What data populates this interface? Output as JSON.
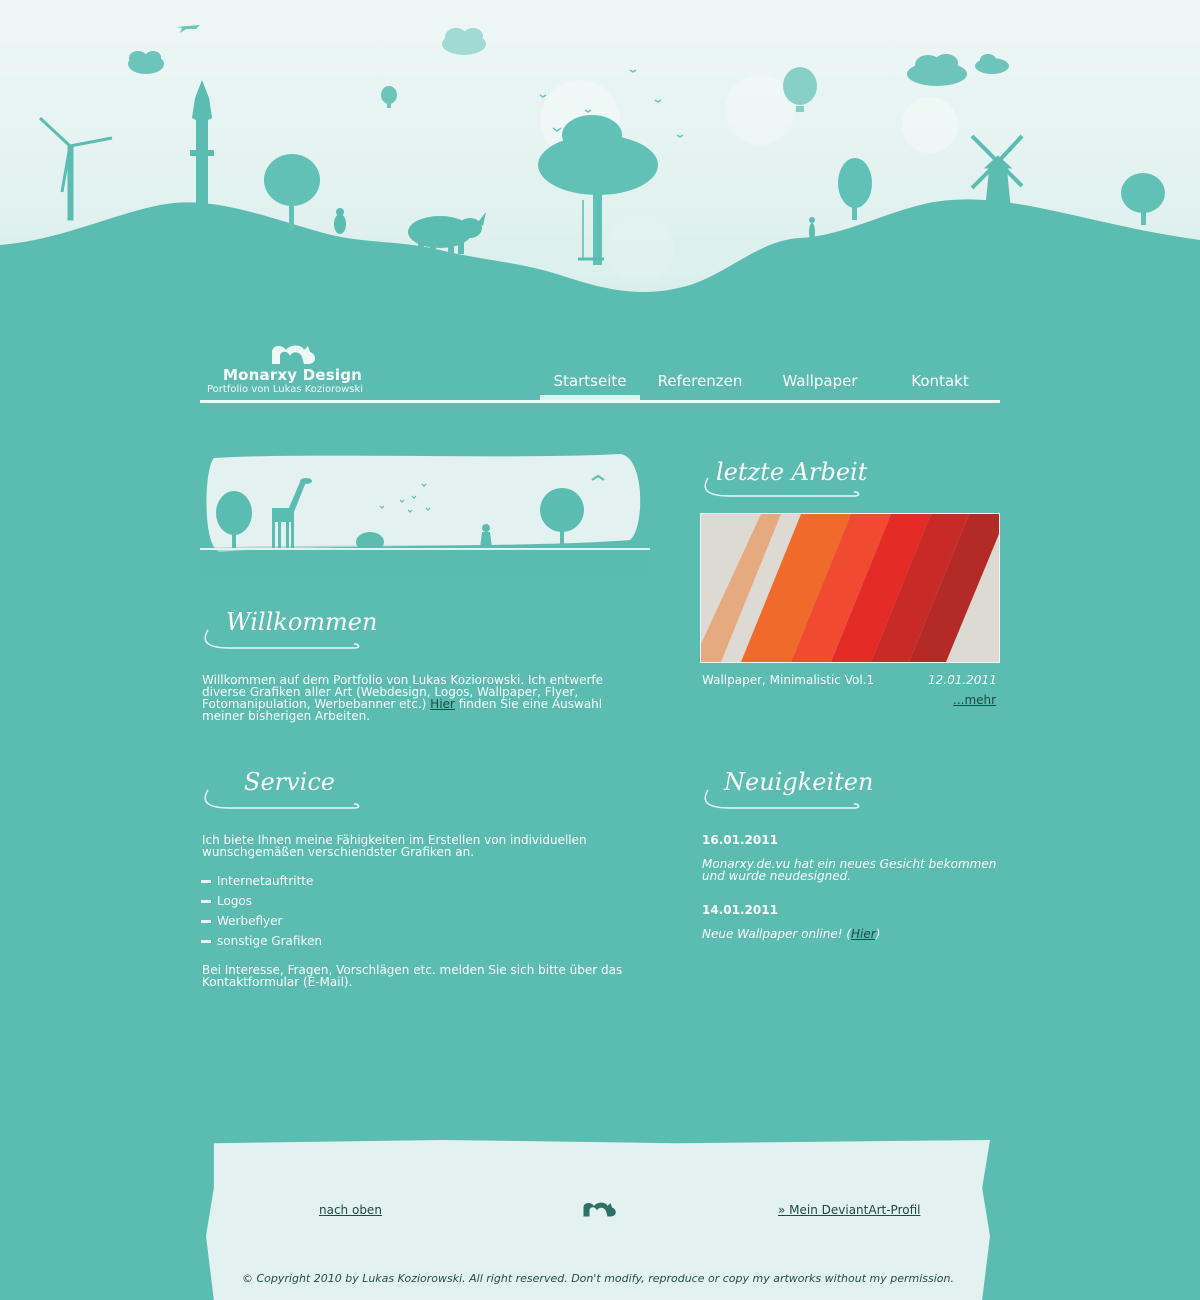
{
  "brand": {
    "title": "Monarxy Design",
    "subtitle": "Portfolio von Lukas Koziorowski"
  },
  "nav": [
    {
      "label": "Startseite",
      "active": true
    },
    {
      "label": "Referenzen",
      "active": false
    },
    {
      "label": "Wallpaper",
      "active": false
    },
    {
      "label": "Kontakt",
      "active": false
    }
  ],
  "colors": {
    "background": "#5bbcb1",
    "sky": "#e3f2f0",
    "dark_link": "#1f4a45",
    "silhouette": "#5bbcb1"
  },
  "welcome": {
    "heading": "Willkommen",
    "text_before_link": "Willkommen auf dem Portfolio von Lukas Koziorowski. Ich entwerfe diverse Grafiken aller Art (Webdesign, Logos, Wallpaper, Flyer, Fotomanipulation, Werbebanner etc.)",
    "link": "Hier",
    "text_after_link": "finden Sie eine Auswahl meiner bisherigen Arbeiten."
  },
  "service": {
    "heading": "Service",
    "intro": "Ich biete Ihnen meine Fähigkeiten im Erstellen von individuellen wunschgemäßen verschiendster Grafiken an.",
    "items": [
      "Internetauftritte",
      "Logos",
      "Werbeflyer",
      "sonstige Grafiken"
    ],
    "outro": "Bei Interesse, Fragen, Vorschlägen etc. melden Sie sich bitte über das Kontaktformular (E-Mail)."
  },
  "latest_work": {
    "heading": "letzte Arbeit",
    "caption": "Wallpaper, Minimalistic Vol.1",
    "date": "12.01.2011",
    "more": "...mehr"
  },
  "news": {
    "heading": "Neuigkeiten",
    "entries": [
      {
        "date": "16.01.2011",
        "text": "Monarxy.de.vu hat ein neues Gesicht bekommen und wurde neudesigned.",
        "link": ""
      },
      {
        "date": "14.01.2011",
        "text_before": "Neue Wallpaper online! (",
        "link": "Hier",
        "text_after": ")"
      }
    ]
  },
  "footer": {
    "back_to_top": "nach oben",
    "deviantart": "» Mein DeviantArt-Profil",
    "copyright": "© Copyright 2010 by Lukas Koziorowski. All right reserved. Don't modify, reproduce or copy my artworks without my permission."
  },
  "icons": [
    "logo-icon",
    "windmill-icon",
    "wind-turbine-icon",
    "tower-icon",
    "rhino-icon",
    "tree-icon",
    "balloon-icon",
    "cloud-icon",
    "plane-icon",
    "giraffe-icon"
  ]
}
